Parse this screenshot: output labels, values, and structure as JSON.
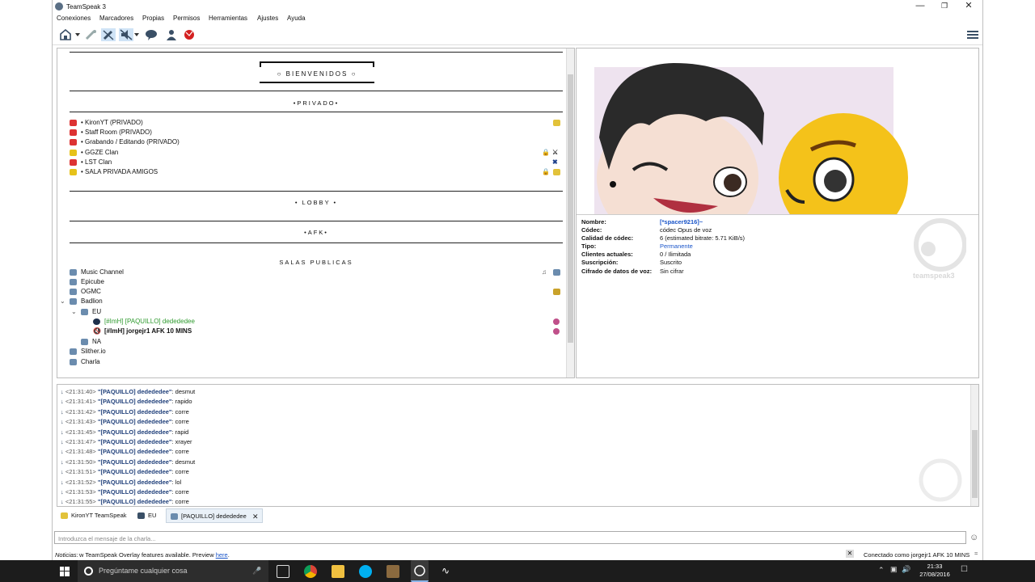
{
  "window": {
    "title": "TeamSpeak 3"
  },
  "menu": [
    "Conexiones",
    "Marcadores",
    "Propias",
    "Permisos",
    "Herramientas",
    "Ajustes",
    "Ayuda"
  ],
  "tree": {
    "welcome": "BIENVENIDOS",
    "privado_header": "•PRIVADO•",
    "privado": [
      "• KironYT (PRIVADO)",
      "• Staff Room (PRIVADO)",
      "• Grabando / Editando (PRIVADO)",
      "• GGZE Clan",
      "• LST Clan",
      "• SALA PRIVADA AMIGOS"
    ],
    "lobby": "• LOBBY •",
    "afk": "•AFK•",
    "publicas_header": "SALAS PUBLICAS",
    "publicas": [
      "Music Channel",
      "Epicube",
      "OGMC",
      "Badlion"
    ],
    "eu": "EU",
    "users": [
      "[#ImH] [PAQUILLO] dedededee",
      "[#ImH] jorgejr1 AFK 10 MINS"
    ],
    "after": [
      "NA",
      "Slither.io",
      "Charla"
    ]
  },
  "info": {
    "rows": [
      {
        "k": "Nombre:",
        "v": "[*spacer9216]~"
      },
      {
        "k": "Códec:",
        "v": "códec Opus de voz"
      },
      {
        "k": "Calidad de códec:",
        "v": "6 (estimated bitrate: 5.71 KiB/s)"
      },
      {
        "k": "Tipo:",
        "v": "Permanente"
      },
      {
        "k": "Clientes actuales:",
        "v": "0 / Ilimitada"
      },
      {
        "k": "Suscripción:",
        "v": "Suscrito"
      },
      {
        "k": "Cifrado de datos de voz:",
        "v": "Sin cifrar"
      }
    ],
    "watermark": "teamspeak3",
    "colors": {
      "link": "#1a55c9"
    }
  },
  "chat": [
    {
      "t": "<21:31:40>",
      "n": "\"[PAQUILLO] dedededee\"",
      "m": ": desmut"
    },
    {
      "t": "<21:31:41>",
      "n": "\"[PAQUILLO] dedededee\"",
      "m": ": rapido"
    },
    {
      "t": "<21:31:42>",
      "n": "\"[PAQUILLO] dedededee\"",
      "m": ": corre"
    },
    {
      "t": "<21:31:43>",
      "n": "\"[PAQUILLO] dedededee\"",
      "m": ": corre"
    },
    {
      "t": "<21:31:45>",
      "n": "\"[PAQUILLO] dedededee\"",
      "m": ": rapid"
    },
    {
      "t": "<21:31:47>",
      "n": "\"[PAQUILLO] dedededee\"",
      "m": ": xrayer"
    },
    {
      "t": "<21:31:48>",
      "n": "\"[PAQUILLO] dedededee\"",
      "m": ": corre"
    },
    {
      "t": "<21:31:50>",
      "n": "\"[PAQUILLO] dedededee\"",
      "m": ": desmut"
    },
    {
      "t": "<21:31:51>",
      "n": "\"[PAQUILLO] dedededee\"",
      "m": ": corre"
    },
    {
      "t": "<21:31:52>",
      "n": "\"[PAQUILLO] dedededee\"",
      "m": ": lol"
    },
    {
      "t": "<21:31:53>",
      "n": "\"[PAQUILLO] dedededee\"",
      "m": ": corre"
    },
    {
      "t": "<21:31:55>",
      "n": "\"[PAQUILLO] dedededee\"",
      "m": ": corre"
    }
  ],
  "tabs": [
    "KironYT TeamSpeak",
    "EU",
    "[PAQUILLO] dedededee"
  ],
  "input": {
    "placeholder": "Introduzca el mensaje de la charla..."
  },
  "status": {
    "label": "Noticias:",
    "text": "w TeamSpeak Overlay features available. Preview ",
    "link": "here",
    "dot": ".",
    "connected": "Conectado como jorgejr1 AFK 10 MINS"
  },
  "taskbar": {
    "search": "Pregúntame cualquier cosa",
    "time": "21:33",
    "date": "27/08/2016"
  }
}
